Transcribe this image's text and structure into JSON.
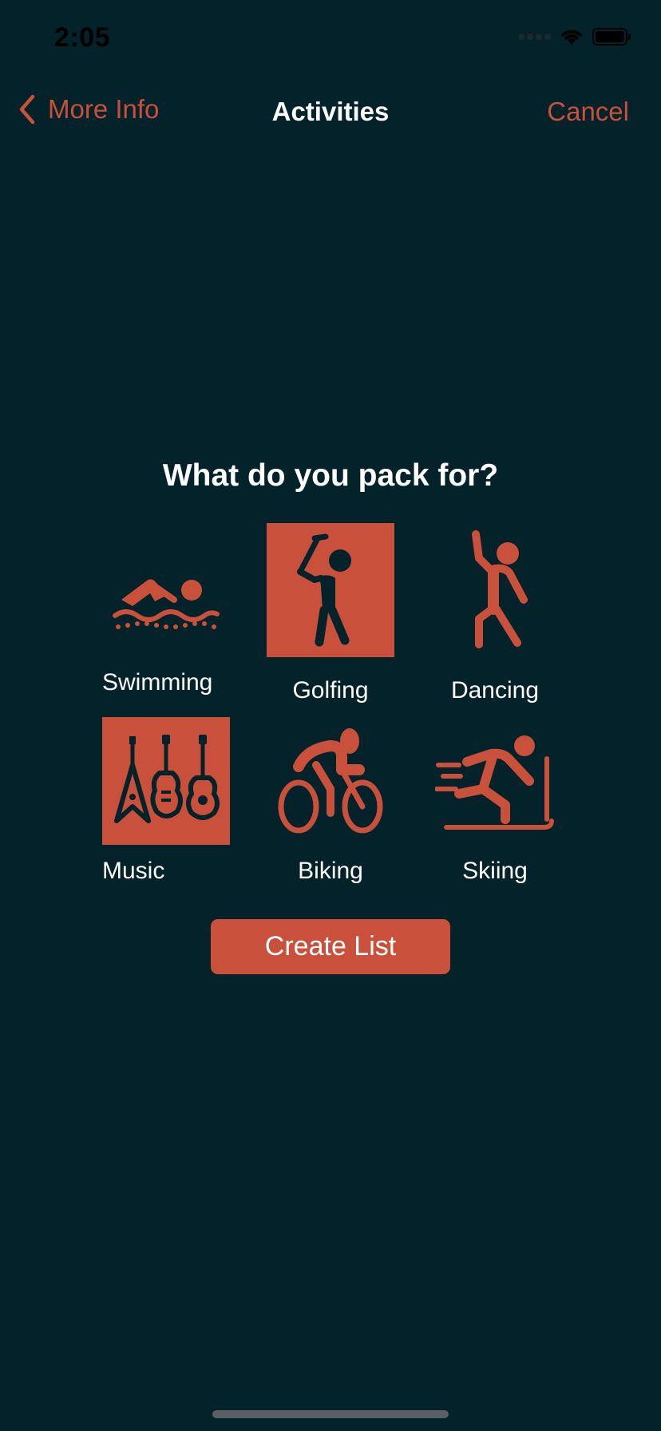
{
  "status_bar": {
    "time": "2:05"
  },
  "nav": {
    "back_label": "More Info",
    "title": "Activities",
    "cancel_label": "Cancel"
  },
  "main": {
    "question": "What do you pack for?",
    "activities": [
      {
        "label": "Swimming",
        "icon": "swimming-icon",
        "selected": false
      },
      {
        "label": "Golfing",
        "icon": "golfing-icon",
        "selected": true
      },
      {
        "label": "Dancing",
        "icon": "dancing-icon",
        "selected": false
      },
      {
        "label": "Music",
        "icon": "music-icon",
        "selected": true
      },
      {
        "label": "Biking",
        "icon": "biking-icon",
        "selected": false
      },
      {
        "label": "Skiing",
        "icon": "skiing-icon",
        "selected": false
      }
    ],
    "create_button_label": "Create List"
  },
  "colors": {
    "background": "#03222a",
    "accent": "#c9503b",
    "text": "#ffffff"
  }
}
